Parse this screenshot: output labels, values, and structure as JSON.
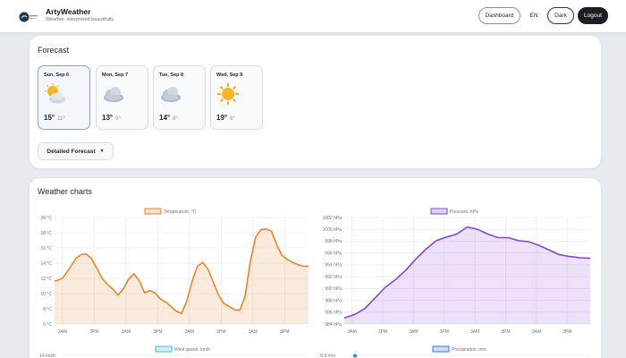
{
  "header": {
    "app_title": "ArtyWeather",
    "tagline": "Weather, interpreted beautifully.",
    "nav": {
      "dashboard": "Dashboard",
      "lang": "EN",
      "theme": "Dark",
      "logout": "Logout"
    }
  },
  "forecast": {
    "title": "Forecast",
    "days": [
      {
        "name": "Sun, Sep 6",
        "icon": "sun-behind-cloud-icon",
        "hi": "15°",
        "lo": "11°",
        "selected": true
      },
      {
        "name": "Mon, Sep 7",
        "icon": "cloud-icon",
        "hi": "13°",
        "lo": "9°"
      },
      {
        "name": "Tue, Sep 8",
        "icon": "cloud-icon",
        "hi": "14°",
        "lo": "8°"
      },
      {
        "name": "Wed, Sep 9",
        "icon": "sun-icon",
        "hi": "19°",
        "lo": "6°"
      }
    ],
    "detail_button": "Detailed Forecast",
    "detail_caret": "▼"
  },
  "charts": {
    "title": "Weather charts"
  },
  "colors": {
    "temperature": "#e8852e",
    "pressure": "#8646d6",
    "wind": "#3ec1d3",
    "precipitation": "#3d7bc6"
  },
  "chart_data": [
    {
      "type": "line",
      "legend": "Temperature, °C",
      "ylim": [
        6,
        20
      ],
      "y_ticks": [
        "20 °C",
        "18 °C",
        "16 °C",
        "14 °C",
        "12 °C",
        "10 °C",
        "8 °C",
        "6 °C"
      ],
      "x_ticks": [
        "3AM",
        "3PM",
        "3AM",
        "3PM",
        "3AM",
        "3PM",
        "3AM",
        "3PM"
      ],
      "x_hours": [
        3,
        15,
        27,
        39,
        51,
        63,
        75,
        87
      ],
      "xlim": [
        0,
        96
      ],
      "fill": true,
      "grid": true,
      "legend_position": "top",
      "series": [
        {
          "name": "Temperature, °C",
          "x": [
            0,
            3,
            6,
            8,
            10,
            12,
            14,
            16,
            18,
            20,
            22,
            24,
            26,
            28,
            30,
            32,
            34,
            36,
            38,
            40,
            42,
            44,
            46,
            48,
            50,
            52,
            54,
            56,
            58,
            60,
            62,
            64,
            66,
            68,
            70,
            72,
            74,
            76,
            78,
            80,
            82,
            84,
            86,
            88,
            90,
            92,
            94,
            96
          ],
          "y": [
            11.6,
            12.0,
            13.5,
            14.6,
            15.1,
            15.2,
            14.6,
            13.3,
            12.0,
            11.2,
            10.6,
            9.8,
            10.6,
            11.9,
            12.6,
            11.7,
            10.1,
            10.4,
            10.1,
            9.3,
            8.9,
            8.3,
            7.7,
            7.4,
            9.0,
            11.6,
            13.6,
            14.1,
            13.2,
            11.5,
            9.8,
            8.7,
            8.3,
            7.9,
            7.8,
            9.6,
            14.2,
            17.4,
            18.4,
            18.5,
            18.2,
            16.4,
            15.0,
            14.5,
            14.1,
            13.8,
            13.6,
            13.6
          ]
        }
      ]
    },
    {
      "type": "line",
      "legend": "Pressure, hPa",
      "ylim": [
        984,
        1002
      ],
      "y_ticks": [
        "1002 hPa",
        "1000 hPa",
        "998 hPa",
        "996 hPa",
        "994 hPa",
        "992 hPa",
        "990 hPa",
        "988 hPa",
        "986 hPa",
        "984 hPa"
      ],
      "x_ticks": [
        "3AM",
        "3PM",
        "3AM",
        "3PM",
        "3AM",
        "3PM",
        "3AM",
        "3PM"
      ],
      "x_hours": [
        3,
        15,
        27,
        39,
        51,
        63,
        75,
        87
      ],
      "xlim": [
        0,
        96
      ],
      "fill": true,
      "grid": true,
      "legend_position": "top",
      "series": [
        {
          "name": "Pressure, hPa",
          "x": [
            0,
            4,
            8,
            12,
            16,
            20,
            24,
            28,
            32,
            36,
            40,
            44,
            48,
            52,
            56,
            60,
            64,
            68,
            72,
            76,
            80,
            84,
            88,
            92,
            96
          ],
          "y": [
            985.0,
            985.6,
            986.6,
            988.4,
            990.2,
            991.5,
            993.1,
            995.0,
            996.7,
            998.1,
            998.7,
            999.2,
            1000.4,
            1000.0,
            999.2,
            998.6,
            998.6,
            998.1,
            997.9,
            997.3,
            996.5,
            995.7,
            995.4,
            995.2,
            995.1
          ]
        }
      ]
    },
    {
      "type": "line",
      "legend": "Wind speed, km/h",
      "y_ticks": [
        "14 km/h"
      ],
      "grid": true,
      "legend_position": "top"
    },
    {
      "type": "line",
      "legend": "Precipitation, mm",
      "y_ticks": [
        "0.9 mm"
      ],
      "grid": true,
      "legend_position": "top"
    }
  ]
}
